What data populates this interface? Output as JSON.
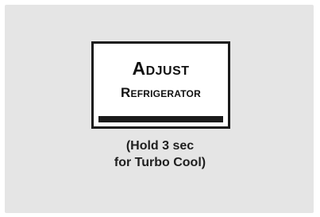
{
  "button": {
    "title": "Adjust",
    "subtitle": "Refrigerator"
  },
  "hint": {
    "line1": "(Hold 3 sec",
    "line2": "for Turbo Cool)"
  },
  "colors": {
    "panel_background": "#e5e5e5",
    "button_border": "#1a1a1a",
    "button_background": "#ffffff",
    "text": "#111111"
  }
}
